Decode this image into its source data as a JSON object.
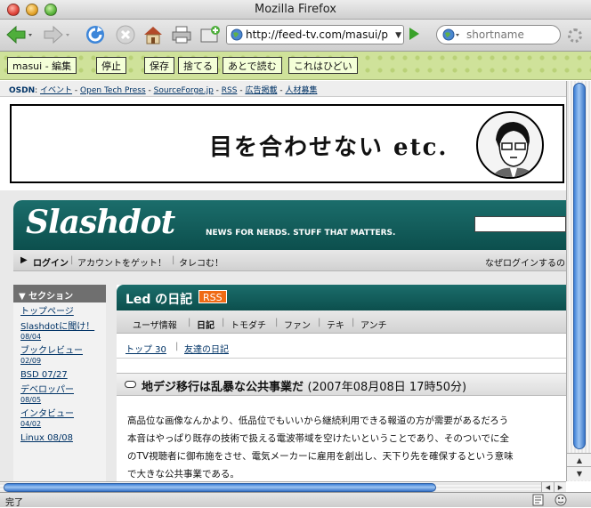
{
  "window": {
    "title": "Mozilla Firefox"
  },
  "toolbar": {
    "url": "http://feed-tv.com/masui/p",
    "search_placeholder": "shortname"
  },
  "bookmarklets": [
    "masui - 編集",
    "停止",
    "保存",
    "捨てる",
    "あとで読む",
    "これはひどい"
  ],
  "osdn": {
    "prefix": "OSDN",
    "links": [
      "イベント",
      "Open Tech Press",
      "SourceForge.jp",
      "RSS",
      "広告掲載",
      "人材募集"
    ]
  },
  "banner": {
    "text": "目を合わせない etc."
  },
  "slashdot": {
    "logo": "Slashdot",
    "tagline": "NEWS FOR NERDS. STUFF THAT MATTERS.",
    "login": "ログイン",
    "create_account": "アカウントをゲット！",
    "tarekomi": "タレコむ！",
    "why_login": "なぜログインするの"
  },
  "sidebar": {
    "heading": "セクション",
    "items": [
      {
        "label": "トップページ",
        "date": ""
      },
      {
        "label": "Slashdotに聞け！",
        "date": "08/04"
      },
      {
        "label": "ブックレビュー",
        "date": "02/09"
      },
      {
        "label": "BSD 07/27",
        "date": ""
      },
      {
        "label": "デベロッパー",
        "date": "08/05"
      },
      {
        "label": "インタビュー",
        "date": "04/02"
      },
      {
        "label": "Linux 08/08",
        "date": ""
      }
    ]
  },
  "journal": {
    "owner": "Led の日記",
    "rss": "RSS",
    "tabs": [
      "ユーザ情報",
      "日記",
      "トモダチ",
      "ファン",
      "テキ",
      "アンチ"
    ],
    "subnav": [
      "トップ 30",
      "友達の日記"
    ],
    "article_title": "地デジ移行は乱暴な公共事業だ",
    "article_date": "(2007年08月08日 17時50分)",
    "body": [
      "高品位な画像なんかより、低品位でもいいから継続利用できる報道の方が需要があるだろう",
      "本音はやっぱり既存の技術で扱える電波帯域を空けたいということであり、そのついでに全",
      "のTV視聴者に御布施をさせ、電気メーカーに雇用を創出し、天下り先を確保するという意味",
      "で大きな公共事業である。"
    ]
  },
  "status": {
    "text": "完了"
  }
}
